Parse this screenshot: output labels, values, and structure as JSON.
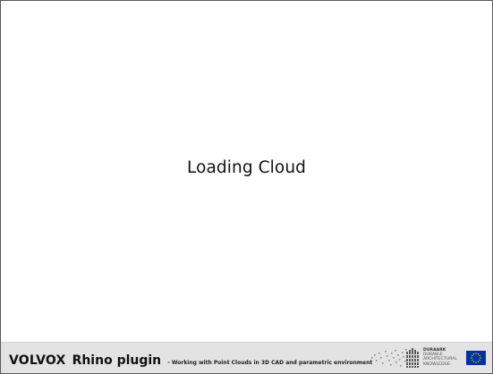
{
  "slide": {
    "center_text": "Loading Cloud"
  },
  "footer": {
    "brand": "VOLVOX",
    "product": "Rhino plugin",
    "subtitle": "- Working with Point Clouds in 3D CAD and parametric environment",
    "partner_logo": {
      "lines": [
        "DURAARK",
        "DURABLE",
        "ARCHITECTURAL",
        "KNOWLEDGE"
      ]
    },
    "flag_icon": "eu-flag-icon"
  },
  "colors": {
    "footer_background": "#e3e3e3",
    "flag_blue": "#0033a0",
    "flag_stars": "#ffcc00"
  }
}
